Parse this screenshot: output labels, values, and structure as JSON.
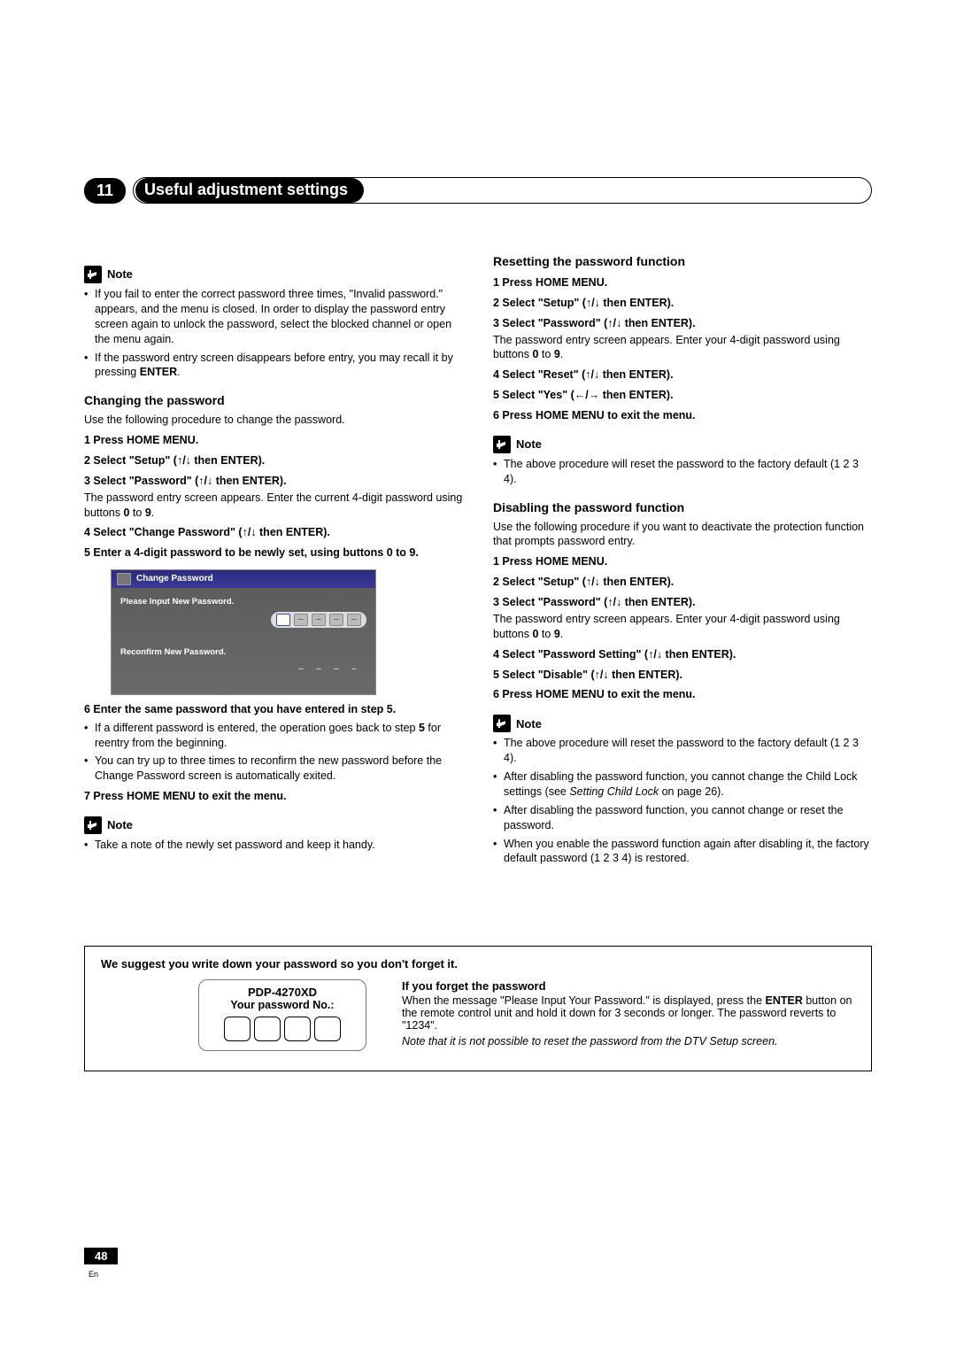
{
  "chapter_number": "11",
  "chapter_title": "Useful adjustment settings",
  "page_number": "48",
  "page_lang": "En",
  "note_label": "Note",
  "left": {
    "note1_b1": "If you fail to enter the correct password three times, \"Invalid password.\" appears, and the menu is closed. In order to display the password entry screen again to unlock the password, select the blocked channel or open the menu again.",
    "note1_b2_a": "If the password entry screen disappears before entry, you may recall it by pressing ",
    "note1_b2_b": "ENTER",
    "note1_b2_c": ".",
    "h_change": "Changing the password",
    "lead_change": "Use the following procedure to change the password.",
    "s1": "1   Press HOME MENU.",
    "s2": "2   Select \"Setup\" (↑/↓ then ENTER).",
    "s3": "3   Select \"Password\" (↑/↓ then ENTER).",
    "s3_note_a": "The password entry screen appears. Enter the current 4-digit password using buttons ",
    "s3_note_b": "0",
    "s3_note_c": " to ",
    "s3_note_d": "9",
    "s3_note_e": ".",
    "s4": "4   Select \"Change Password\" (↑/↓ then ENTER).",
    "s5": "5   Enter a 4-digit password to be newly set, using buttons 0 to 9.",
    "shot_title": "Change Password",
    "shot_l1": "Please Input New Password.",
    "shot_l2": "Reconfirm New Password.",
    "s6": "6   Enter the same password that you have entered in step 5.",
    "s6_b1_a": "If a different password is entered, the operation goes back to step ",
    "s6_b1_b": "5",
    "s6_b1_c": " for reentry from the beginning.",
    "s6_b2": "You can try up to three times to reconfirm the new password before the Change Password screen is automatically exited.",
    "s7": "7   Press HOME MENU to exit the menu.",
    "note2_b1": "Take a note of the newly set password and keep it handy."
  },
  "right": {
    "h_reset": "Resetting the password function",
    "r1": "1   Press HOME MENU.",
    "r2": "2   Select \"Setup\" (↑/↓ then ENTER).",
    "r3": "3   Select \"Password\" (↑/↓ then ENTER).",
    "r3_note_a": "The password entry screen appears. Enter your 4-digit password using buttons ",
    "r3_note_b": "0",
    "r3_note_c": " to ",
    "r3_note_d": "9",
    "r3_note_e": ".",
    "r4": "4   Select \"Reset\" (↑/↓ then ENTER).",
    "r5": "5   Select \"Yes\" (←/→ then ENTER).",
    "r6": "6   Press HOME MENU to exit the menu.",
    "noteA_b1": "The above procedure will reset the password to the factory default (1 2 3 4).",
    "h_disable": "Disabling the password function",
    "lead_disable": "Use the following procedure if you want to deactivate the protection function that prompts password entry.",
    "d1": "1   Press HOME MENU.",
    "d2": "2   Select \"Setup\" (↑/↓ then ENTER).",
    "d3": "3   Select \"Password\" (↑/↓ then ENTER).",
    "d3_note_a": "The password entry screen appears. Enter your 4-digit password using buttons ",
    "d3_note_b": "0",
    "d3_note_c": " to ",
    "d3_note_d": "9",
    "d3_note_e": ".",
    "d4": "4   Select \"Password Setting\" (↑/↓ then ENTER).",
    "d5": "5   Select \"Disable\" (↑/↓ then ENTER).",
    "d6": "6   Press HOME MENU to exit the menu.",
    "noteB_b1": "The above procedure will reset the password to the factory default (1 2 3 4).",
    "noteB_b2_a": "After disabling the password function, you cannot change the Child Lock settings (see ",
    "noteB_b2_b": "Setting Child Lock",
    "noteB_b2_c": " on page 26).",
    "noteB_b3": "After disabling the password function, you cannot change or reset the password.",
    "noteB_b4": "When you enable the password function again after disabling it, the factory default password (1 2 3 4) is restored."
  },
  "pwbox": {
    "head": "We suggest you write down your password so you don't forget it.",
    "model": "PDP-4270XD",
    "label": "Your password No.:",
    "h": "If you forget the password",
    "p_a": "When the message \"Please Input Your Password.\" is displayed, press the ",
    "p_b": "ENTER",
    "p_c": " button on the remote control unit and hold it down for 3 seconds or longer. The password reverts to \"1234\".",
    "ital": "Note that it is not possible to reset the password from the DTV Setup screen."
  }
}
